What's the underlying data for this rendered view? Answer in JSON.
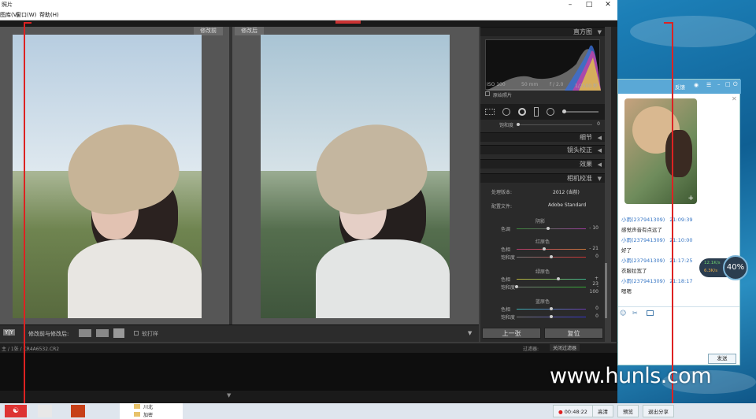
{
  "window": {
    "title": "照片",
    "menus": [
      "图库(V)",
      "窗口(W)",
      "帮助(H)"
    ]
  },
  "compare": {
    "before_label": "修改前",
    "after_label": "修改后"
  },
  "panel": {
    "histogram_label": "直方图",
    "exif": {
      "iso": "ISO 100",
      "focal": "50 mm",
      "aperture": "f / 2.0",
      "shutter": "1/2500 秒"
    },
    "original_photo_label": "原始照片",
    "saturation_label": "饱和度",
    "saturation_value": "0",
    "sections": {
      "detail": "细节",
      "lens": "镜头校正",
      "effects": "效果",
      "camera": "相机校准"
    },
    "process": {
      "label": "处理版本:",
      "value": "2012 (当前)"
    },
    "profile": {
      "label": "配置文件:",
      "value": "Adobe Standard"
    },
    "shadow": {
      "title": "阴影",
      "tint_label": "色调",
      "tint_value": "- 10",
      "tint_pos": 0.45
    },
    "red": {
      "title": "红原色",
      "hue_label": "色相",
      "hue_value": "- 21",
      "hue_pos": 0.4,
      "sat_label": "饱和度",
      "sat_value": "0",
      "sat_pos": 0.5
    },
    "green": {
      "title": "绿原色",
      "hue_label": "色相",
      "hue_value": "+ 23",
      "hue_pos": 0.6,
      "sat_label": "饱和度",
      "sat_value": "- 100",
      "sat_pos": 0.0
    },
    "blue": {
      "title": "蓝原色",
      "hue_label": "色相",
      "hue_value": "0",
      "hue_pos": 0.5,
      "sat_label": "饱和度",
      "sat_value": "0",
      "sat_pos": 0.5
    },
    "prev_button": "上一张",
    "reset_button": "复位"
  },
  "toolbar": {
    "yy": "Y|Y",
    "compare_text": "修改前与修改后:",
    "soft_proof": "软打样"
  },
  "filmbar": {
    "path": "主 / 1张 / CR4A6532.CR2",
    "filter_label": "过滤器:",
    "filter_value": "关闭过滤器"
  },
  "chat": {
    "title_btn": "反馈",
    "messages": [
      {
        "name": "小雨(237941309)",
        "time": "21:09:39",
        "text": "感觉声音有点远了"
      },
      {
        "name": "小雨(237941309)",
        "time": "21:10:00",
        "text": "好了"
      },
      {
        "name": "小雨(237941309)",
        "time": "21:17:25",
        "text": "衣服拉宽了"
      },
      {
        "name": "小雨(237941309)",
        "time": "21:18:17",
        "text": "嗯嗯"
      }
    ],
    "send_button": "发送"
  },
  "speed": {
    "up": "12.1K/s",
    "down": "6.3K/s",
    "percent": "40%"
  },
  "watermark": "www.hunls.com",
  "taskbar": {
    "folders": [
      "川北",
      "加密"
    ],
    "timer": "00:48:22",
    "buttons": [
      "高清",
      "预览",
      "退出分享"
    ]
  }
}
